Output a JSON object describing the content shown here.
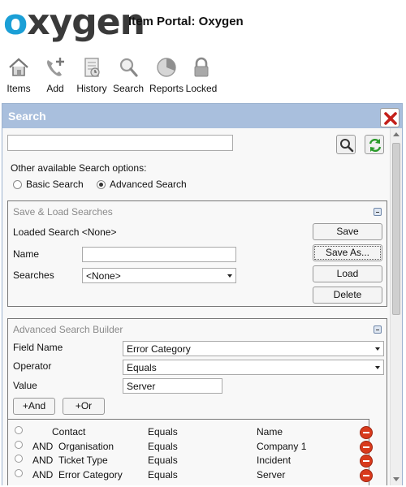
{
  "header": {
    "logo_first": "o",
    "logo_rest": "xygen",
    "title": "Item Portal: Oxygen"
  },
  "toolbar": [
    {
      "label": "Items",
      "icon": "home-icon"
    },
    {
      "label": "Add",
      "icon": "add-phone-icon"
    },
    {
      "label": "History",
      "icon": "history-icon"
    },
    {
      "label": "Search",
      "icon": "search-icon"
    },
    {
      "label": "Reports",
      "icon": "reports-icon"
    },
    {
      "label": "Locked",
      "icon": "lock-icon"
    }
  ],
  "panel": {
    "title": "Search",
    "search_value": "",
    "other_options_label": "Other available Search options:",
    "basic_label": "Basic Search",
    "advanced_label": "Advanced Search",
    "selected_mode": "Advanced Search"
  },
  "save_load": {
    "title": "Save & Load Searches",
    "loaded_label": "Loaded Search",
    "loaded_value": "<None>",
    "name_label": "Name",
    "name_value": "",
    "searches_label": "Searches",
    "searches_value": "<None>",
    "save": "Save",
    "save_as": "Save As...",
    "load": "Load",
    "delete": "Delete"
  },
  "builder": {
    "title": "Advanced Search Builder",
    "field_label": "Field Name",
    "field_value": "Error Category",
    "operator_label": "Operator",
    "operator_value": "Equals",
    "value_label": "Value",
    "value_value": "Server",
    "and_btn": "+And",
    "or_btn": "+Or"
  },
  "results": [
    {
      "conj": "",
      "field": "Contact",
      "op": "Equals",
      "value": "Name"
    },
    {
      "conj": "AND",
      "field": "Organisation",
      "op": "Equals",
      "value": "Company 1"
    },
    {
      "conj": "AND",
      "field": "Ticket Type",
      "op": "Equals",
      "value": "Incident"
    },
    {
      "conj": "AND",
      "field": "Error Category",
      "op": "Equals",
      "value": "Server"
    }
  ],
  "colors": {
    "logo_accent": "#1b9fd6",
    "panel_header": "#a9bfdd",
    "delete_red": "#d83a1c"
  }
}
